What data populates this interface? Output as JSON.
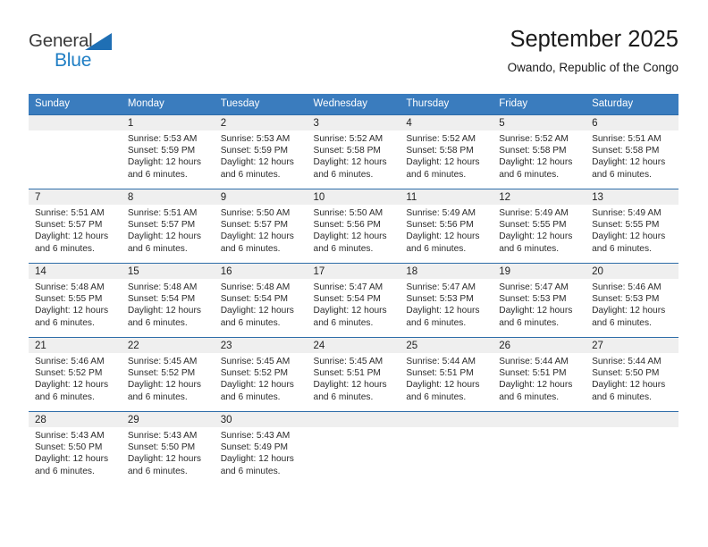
{
  "logo": {
    "word_top": "General",
    "word_bottom": "Blue",
    "triangle_color": "#1f6fb4",
    "text_color": "#3b3b3b",
    "blue_color": "#1f7ec4"
  },
  "header": {
    "title": "September 2025",
    "subtitle": "Owando, Republic of the Congo"
  },
  "theme": {
    "header_row_bg": "#3a7cbe",
    "row_divider": "#2d6ca8",
    "daynum_bg": "#efefef"
  },
  "weekday_headers": [
    "Sunday",
    "Monday",
    "Tuesday",
    "Wednesday",
    "Thursday",
    "Friday",
    "Saturday"
  ],
  "labels": {
    "sunrise_prefix": "Sunrise:",
    "sunset_prefix": "Sunset:",
    "daylight_prefix": "Daylight:"
  },
  "weeks": [
    [
      {
        "day": "",
        "blank": true,
        "sunrise": "",
        "sunset": "",
        "daylight_line1": "",
        "daylight_line2": ""
      },
      {
        "day": "1",
        "blank": false,
        "sunrise": "Sunrise: 5:53 AM",
        "sunset": "Sunset: 5:59 PM",
        "daylight_line1": "Daylight: 12 hours",
        "daylight_line2": "and 6 minutes."
      },
      {
        "day": "2",
        "blank": false,
        "sunrise": "Sunrise: 5:53 AM",
        "sunset": "Sunset: 5:59 PM",
        "daylight_line1": "Daylight: 12 hours",
        "daylight_line2": "and 6 minutes."
      },
      {
        "day": "3",
        "blank": false,
        "sunrise": "Sunrise: 5:52 AM",
        "sunset": "Sunset: 5:58 PM",
        "daylight_line1": "Daylight: 12 hours",
        "daylight_line2": "and 6 minutes."
      },
      {
        "day": "4",
        "blank": false,
        "sunrise": "Sunrise: 5:52 AM",
        "sunset": "Sunset: 5:58 PM",
        "daylight_line1": "Daylight: 12 hours",
        "daylight_line2": "and 6 minutes."
      },
      {
        "day": "5",
        "blank": false,
        "sunrise": "Sunrise: 5:52 AM",
        "sunset": "Sunset: 5:58 PM",
        "daylight_line1": "Daylight: 12 hours",
        "daylight_line2": "and 6 minutes."
      },
      {
        "day": "6",
        "blank": false,
        "sunrise": "Sunrise: 5:51 AM",
        "sunset": "Sunset: 5:58 PM",
        "daylight_line1": "Daylight: 12 hours",
        "daylight_line2": "and 6 minutes."
      }
    ],
    [
      {
        "day": "7",
        "blank": false,
        "sunrise": "Sunrise: 5:51 AM",
        "sunset": "Sunset: 5:57 PM",
        "daylight_line1": "Daylight: 12 hours",
        "daylight_line2": "and 6 minutes."
      },
      {
        "day": "8",
        "blank": false,
        "sunrise": "Sunrise: 5:51 AM",
        "sunset": "Sunset: 5:57 PM",
        "daylight_line1": "Daylight: 12 hours",
        "daylight_line2": "and 6 minutes."
      },
      {
        "day": "9",
        "blank": false,
        "sunrise": "Sunrise: 5:50 AM",
        "sunset": "Sunset: 5:57 PM",
        "daylight_line1": "Daylight: 12 hours",
        "daylight_line2": "and 6 minutes."
      },
      {
        "day": "10",
        "blank": false,
        "sunrise": "Sunrise: 5:50 AM",
        "sunset": "Sunset: 5:56 PM",
        "daylight_line1": "Daylight: 12 hours",
        "daylight_line2": "and 6 minutes."
      },
      {
        "day": "11",
        "blank": false,
        "sunrise": "Sunrise: 5:49 AM",
        "sunset": "Sunset: 5:56 PM",
        "daylight_line1": "Daylight: 12 hours",
        "daylight_line2": "and 6 minutes."
      },
      {
        "day": "12",
        "blank": false,
        "sunrise": "Sunrise: 5:49 AM",
        "sunset": "Sunset: 5:55 PM",
        "daylight_line1": "Daylight: 12 hours",
        "daylight_line2": "and 6 minutes."
      },
      {
        "day": "13",
        "blank": false,
        "sunrise": "Sunrise: 5:49 AM",
        "sunset": "Sunset: 5:55 PM",
        "daylight_line1": "Daylight: 12 hours",
        "daylight_line2": "and 6 minutes."
      }
    ],
    [
      {
        "day": "14",
        "blank": false,
        "sunrise": "Sunrise: 5:48 AM",
        "sunset": "Sunset: 5:55 PM",
        "daylight_line1": "Daylight: 12 hours",
        "daylight_line2": "and 6 minutes."
      },
      {
        "day": "15",
        "blank": false,
        "sunrise": "Sunrise: 5:48 AM",
        "sunset": "Sunset: 5:54 PM",
        "daylight_line1": "Daylight: 12 hours",
        "daylight_line2": "and 6 minutes."
      },
      {
        "day": "16",
        "blank": false,
        "sunrise": "Sunrise: 5:48 AM",
        "sunset": "Sunset: 5:54 PM",
        "daylight_line1": "Daylight: 12 hours",
        "daylight_line2": "and 6 minutes."
      },
      {
        "day": "17",
        "blank": false,
        "sunrise": "Sunrise: 5:47 AM",
        "sunset": "Sunset: 5:54 PM",
        "daylight_line1": "Daylight: 12 hours",
        "daylight_line2": "and 6 minutes."
      },
      {
        "day": "18",
        "blank": false,
        "sunrise": "Sunrise: 5:47 AM",
        "sunset": "Sunset: 5:53 PM",
        "daylight_line1": "Daylight: 12 hours",
        "daylight_line2": "and 6 minutes."
      },
      {
        "day": "19",
        "blank": false,
        "sunrise": "Sunrise: 5:47 AM",
        "sunset": "Sunset: 5:53 PM",
        "daylight_line1": "Daylight: 12 hours",
        "daylight_line2": "and 6 minutes."
      },
      {
        "day": "20",
        "blank": false,
        "sunrise": "Sunrise: 5:46 AM",
        "sunset": "Sunset: 5:53 PM",
        "daylight_line1": "Daylight: 12 hours",
        "daylight_line2": "and 6 minutes."
      }
    ],
    [
      {
        "day": "21",
        "blank": false,
        "sunrise": "Sunrise: 5:46 AM",
        "sunset": "Sunset: 5:52 PM",
        "daylight_line1": "Daylight: 12 hours",
        "daylight_line2": "and 6 minutes."
      },
      {
        "day": "22",
        "blank": false,
        "sunrise": "Sunrise: 5:45 AM",
        "sunset": "Sunset: 5:52 PM",
        "daylight_line1": "Daylight: 12 hours",
        "daylight_line2": "and 6 minutes."
      },
      {
        "day": "23",
        "blank": false,
        "sunrise": "Sunrise: 5:45 AM",
        "sunset": "Sunset: 5:52 PM",
        "daylight_line1": "Daylight: 12 hours",
        "daylight_line2": "and 6 minutes."
      },
      {
        "day": "24",
        "blank": false,
        "sunrise": "Sunrise: 5:45 AM",
        "sunset": "Sunset: 5:51 PM",
        "daylight_line1": "Daylight: 12 hours",
        "daylight_line2": "and 6 minutes."
      },
      {
        "day": "25",
        "blank": false,
        "sunrise": "Sunrise: 5:44 AM",
        "sunset": "Sunset: 5:51 PM",
        "daylight_line1": "Daylight: 12 hours",
        "daylight_line2": "and 6 minutes."
      },
      {
        "day": "26",
        "blank": false,
        "sunrise": "Sunrise: 5:44 AM",
        "sunset": "Sunset: 5:51 PM",
        "daylight_line1": "Daylight: 12 hours",
        "daylight_line2": "and 6 minutes."
      },
      {
        "day": "27",
        "blank": false,
        "sunrise": "Sunrise: 5:44 AM",
        "sunset": "Sunset: 5:50 PM",
        "daylight_line1": "Daylight: 12 hours",
        "daylight_line2": "and 6 minutes."
      }
    ],
    [
      {
        "day": "28",
        "blank": false,
        "sunrise": "Sunrise: 5:43 AM",
        "sunset": "Sunset: 5:50 PM",
        "daylight_line1": "Daylight: 12 hours",
        "daylight_line2": "and 6 minutes."
      },
      {
        "day": "29",
        "blank": false,
        "sunrise": "Sunrise: 5:43 AM",
        "sunset": "Sunset: 5:50 PM",
        "daylight_line1": "Daylight: 12 hours",
        "daylight_line2": "and 6 minutes."
      },
      {
        "day": "30",
        "blank": false,
        "sunrise": "Sunrise: 5:43 AM",
        "sunset": "Sunset: 5:49 PM",
        "daylight_line1": "Daylight: 12 hours",
        "daylight_line2": "and 6 minutes."
      },
      {
        "day": "",
        "blank": true,
        "sunrise": "",
        "sunset": "",
        "daylight_line1": "",
        "daylight_line2": ""
      },
      {
        "day": "",
        "blank": true,
        "sunrise": "",
        "sunset": "",
        "daylight_line1": "",
        "daylight_line2": ""
      },
      {
        "day": "",
        "blank": true,
        "sunrise": "",
        "sunset": "",
        "daylight_line1": "",
        "daylight_line2": ""
      },
      {
        "day": "",
        "blank": true,
        "sunrise": "",
        "sunset": "",
        "daylight_line1": "",
        "daylight_line2": ""
      }
    ]
  ]
}
